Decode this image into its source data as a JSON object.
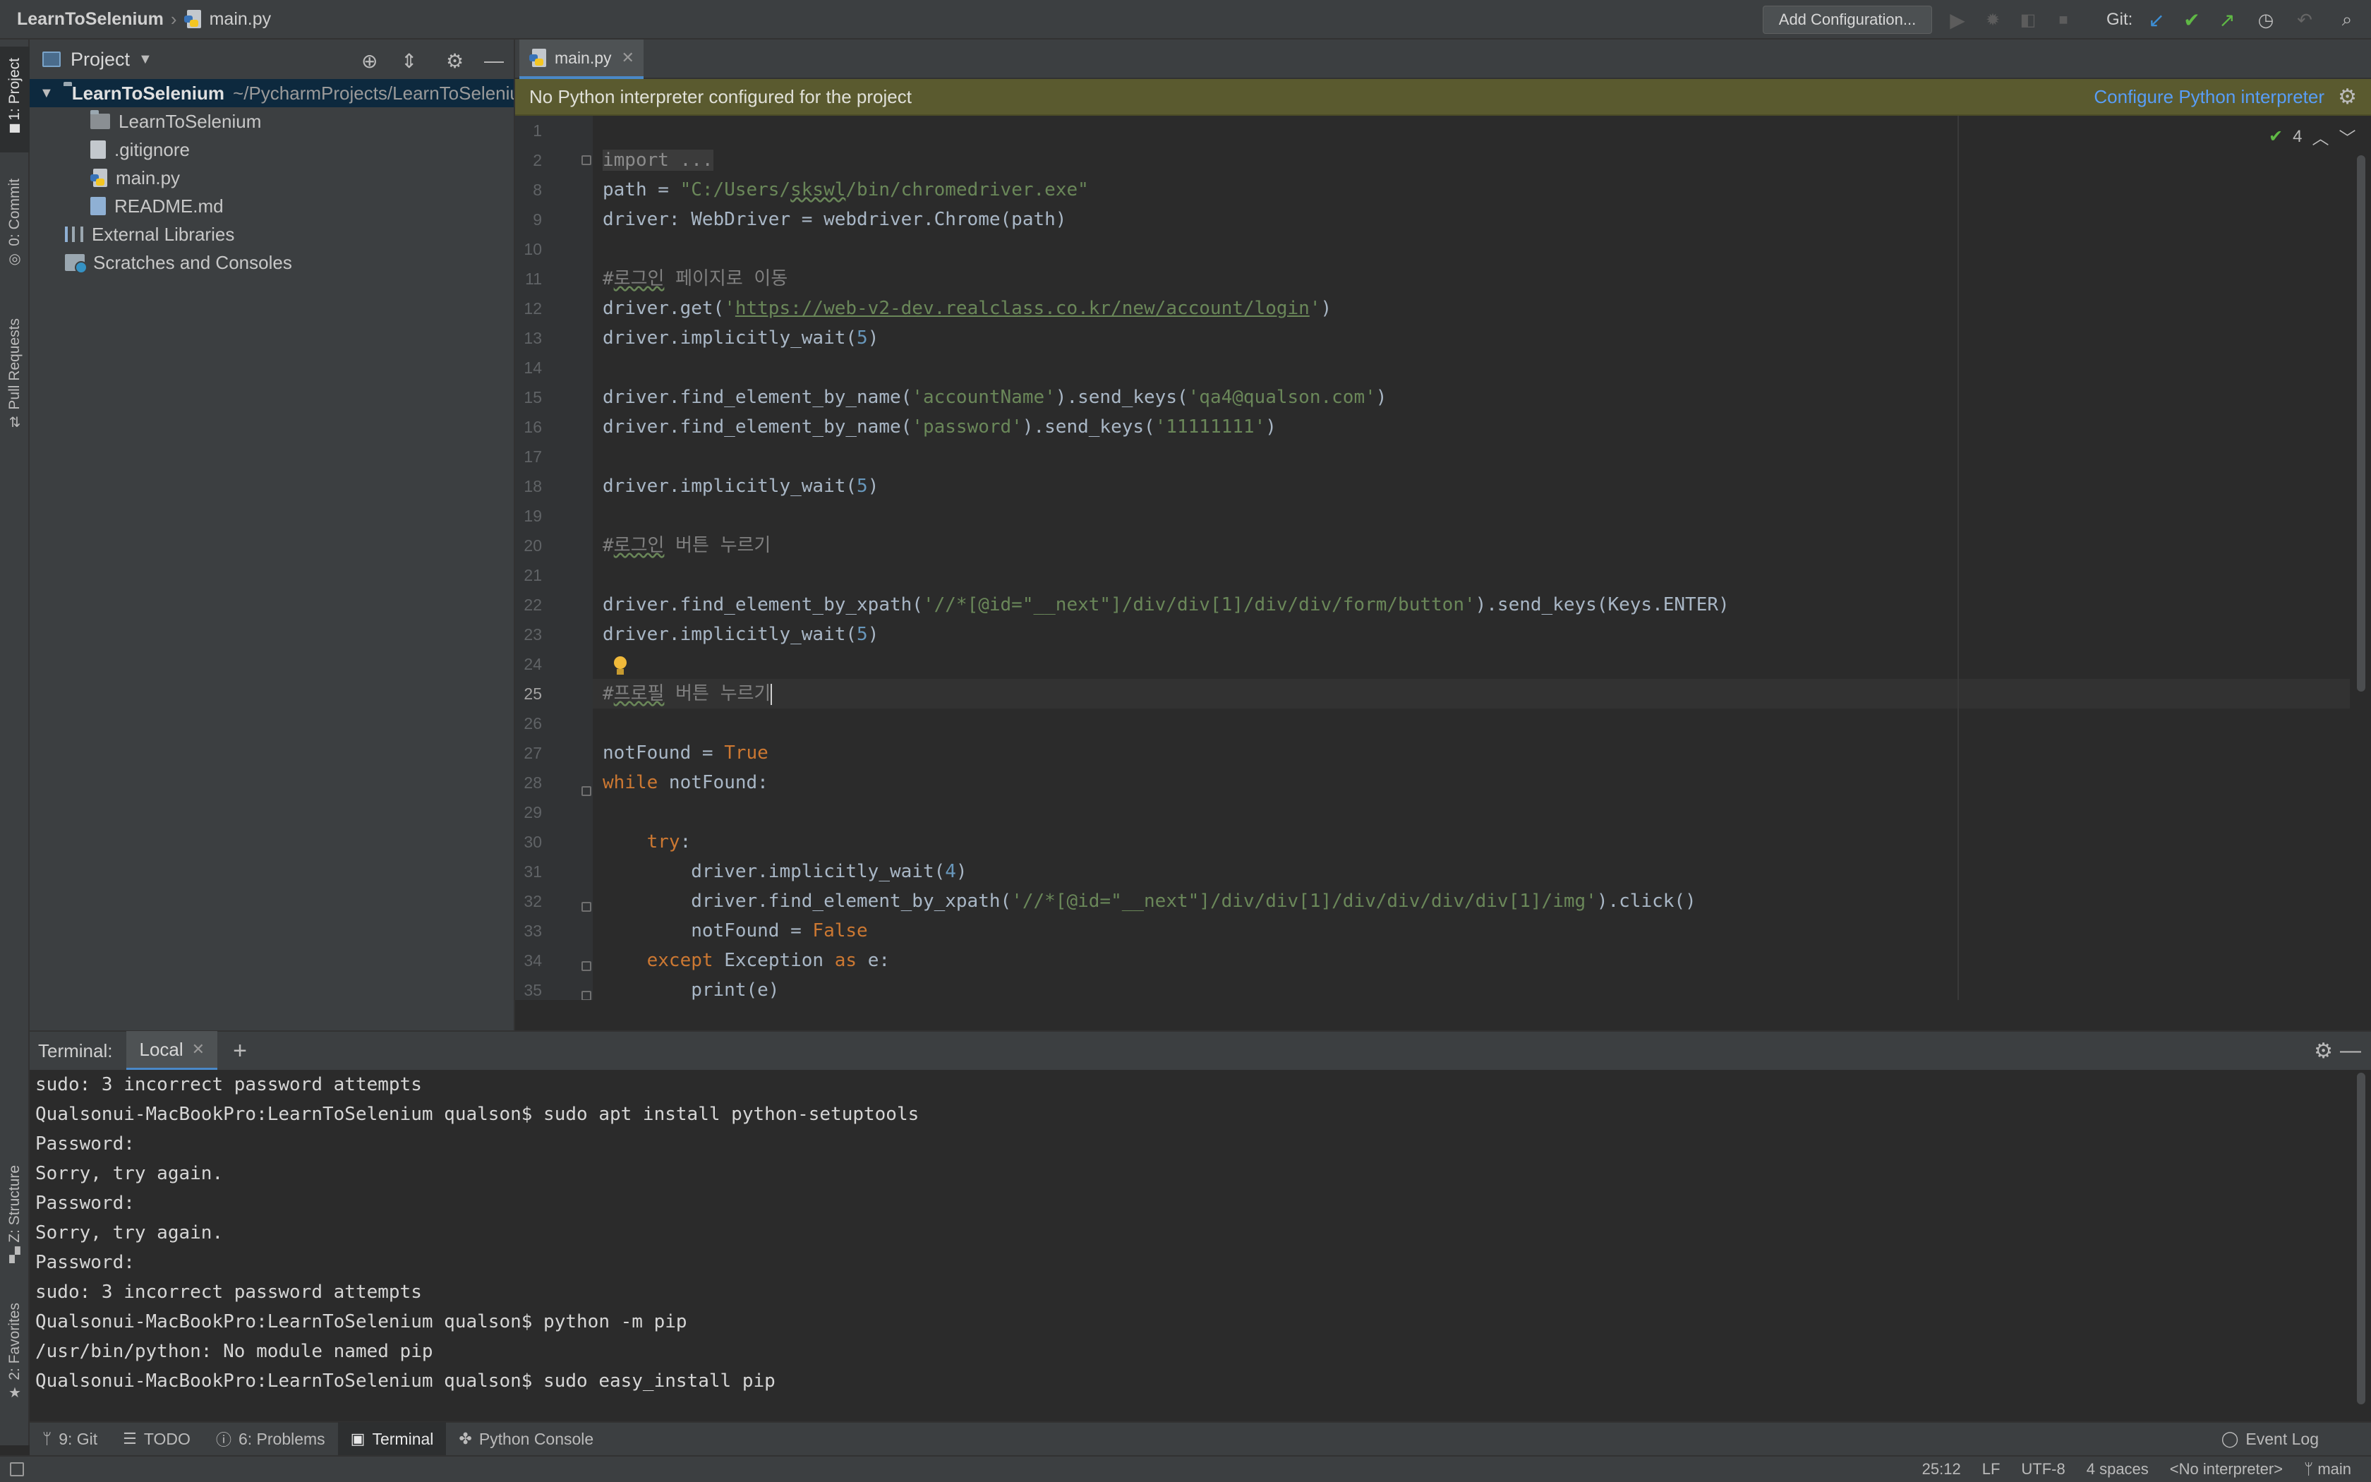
{
  "navbar": {
    "project": "LearnToSelenium",
    "file": "main.py",
    "add_configuration": "Add Configuration...",
    "git_label": "Git:"
  },
  "left_tools": {
    "project": "1: Project",
    "commit": "0: Commit",
    "pull_requests": "Pull Requests",
    "structure": "Z: Structure",
    "favorites": "2: Favorites"
  },
  "project_panel": {
    "title": "Project",
    "root_name": "LearnToSelenium",
    "root_path": "~/PycharmProjects/LearnToSelenium",
    "items": [
      {
        "label": "LearnToSelenium",
        "type": "folder"
      },
      {
        "label": ".gitignore",
        "type": "file"
      },
      {
        "label": "main.py",
        "type": "python"
      },
      {
        "label": "README.md",
        "type": "markdown"
      }
    ],
    "external_libraries": "External Libraries",
    "scratches": "Scratches and Consoles"
  },
  "editor": {
    "tab": "main.py",
    "banner": "No Python interpreter configured for the project",
    "banner_link": "Configure Python interpreter",
    "inspections_count": "4",
    "current_line": 25,
    "line_numbers": [
      1,
      2,
      8,
      9,
      10,
      11,
      12,
      13,
      14,
      15,
      16,
      17,
      18,
      19,
      20,
      21,
      22,
      23,
      24,
      25,
      26,
      27,
      28,
      29,
      30,
      31,
      32,
      33,
      34,
      35
    ]
  },
  "terminal": {
    "label": "Terminal:",
    "tab": "Local",
    "lines": [
      "sudo: 3 incorrect password attempts",
      "Qualsonui-MacBookPro:LearnToSelenium qualson$ sudo apt install python-setuptools",
      "Password:",
      "Sorry, try again.",
      "Password:",
      "Sorry, try again.",
      "Password:",
      "sudo: 3 incorrect password attempts",
      "Qualsonui-MacBookPro:LearnToSelenium qualson$ python -m pip",
      "/usr/bin/python: No module named pip",
      "Qualsonui-MacBookPro:LearnToSelenium qualson$ sudo easy_install pip"
    ]
  },
  "bottom_tabs": {
    "git": "9: Git",
    "todo": "TODO",
    "problems": "6: Problems",
    "terminal": "Terminal",
    "python_console": "Python Console",
    "event_log": "Event Log"
  },
  "status": {
    "position": "25:12",
    "line_sep": "LF",
    "encoding": "UTF-8",
    "indent": "4 spaces",
    "interpreter": "<No interpreter>",
    "branch": "main"
  },
  "colors": {
    "keyword": "#cc7832",
    "string": "#6a8759",
    "number": "#6897bb",
    "comment": "#808080",
    "link": "#589df6",
    "banner_bg": "#5a5a2f"
  }
}
